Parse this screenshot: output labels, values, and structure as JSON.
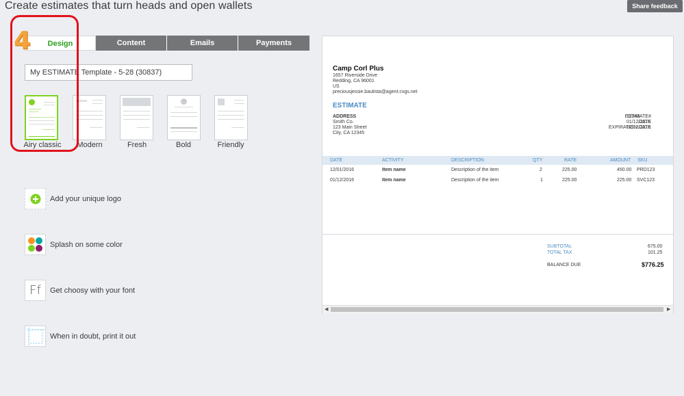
{
  "header": {
    "title": "Create estimates that turn heads and open wallets",
    "share_button": "Share feedback"
  },
  "annotation": {
    "number": "4"
  },
  "tabs": [
    {
      "label": "Design",
      "active": true
    },
    {
      "label": "Content",
      "active": false
    },
    {
      "label": "Emails",
      "active": false
    },
    {
      "label": "Payments",
      "active": false
    }
  ],
  "template_name": "My ESTIMATE Template - 5-28 (30837)",
  "templates": [
    {
      "label": "Airy classic",
      "selected": true
    },
    {
      "label": "Modern",
      "selected": false
    },
    {
      "label": "Fresh",
      "selected": false
    },
    {
      "label": "Bold",
      "selected": false
    },
    {
      "label": "Friendly",
      "selected": false
    }
  ],
  "features": [
    {
      "label": "Add your unique logo",
      "icon": "add-logo-icon"
    },
    {
      "label": "Splash on some color",
      "icon": "color-palette-icon"
    },
    {
      "label": "Get choosy with your font",
      "icon": "font-icon",
      "glyph": "Ff"
    },
    {
      "label": "When in doubt, print it out",
      "icon": "print-margins-icon"
    }
  ],
  "preview": {
    "company_name": "Camp Corl Plus",
    "company_address": [
      "1657 Riverside Drive",
      "Redding, CA 96001",
      "US",
      "preciousjessie.bautista@agent.cvgs.net"
    ],
    "doc_title": "ESTIMATE",
    "address_label": "ADDRESS",
    "address_lines": [
      "Smith Co.",
      "123 Main Street",
      "City, CA 12345"
    ],
    "meta": [
      {
        "label": "ESTIMATE#",
        "value": "12345"
      },
      {
        "label": "DATE",
        "value": "01/12/2016"
      },
      {
        "label": "EXPIRATION DATE",
        "value": "02/12/2016"
      }
    ],
    "columns": [
      "DATE",
      "ACTIVITY",
      "DESCRIPTION",
      "QTY",
      "RATE",
      "AMOUNT",
      "SKU"
    ],
    "rows": [
      [
        "12/01/2016",
        "Item name",
        "Description of the item",
        "2",
        "225.00",
        "450.00",
        "PRD123"
      ],
      [
        "01/12/2016",
        "Item name",
        "Description of the item",
        "1",
        "225.00",
        "225.00",
        "SVC123"
      ]
    ],
    "subtotal_label": "SUBTOTAL",
    "subtotal_value": "675.00",
    "tax_label": "TOTAL TAX",
    "tax_value": "101.25",
    "balance_label": "BALANCE DUE",
    "balance_value": "$776.25"
  },
  "colors": {
    "accent_green": "#2ca01c",
    "tab_gray": "#747577",
    "estimate_blue": "#4a8bc2",
    "annotation_red": "#e1121b",
    "annotation_orange": "#f4a43b"
  }
}
